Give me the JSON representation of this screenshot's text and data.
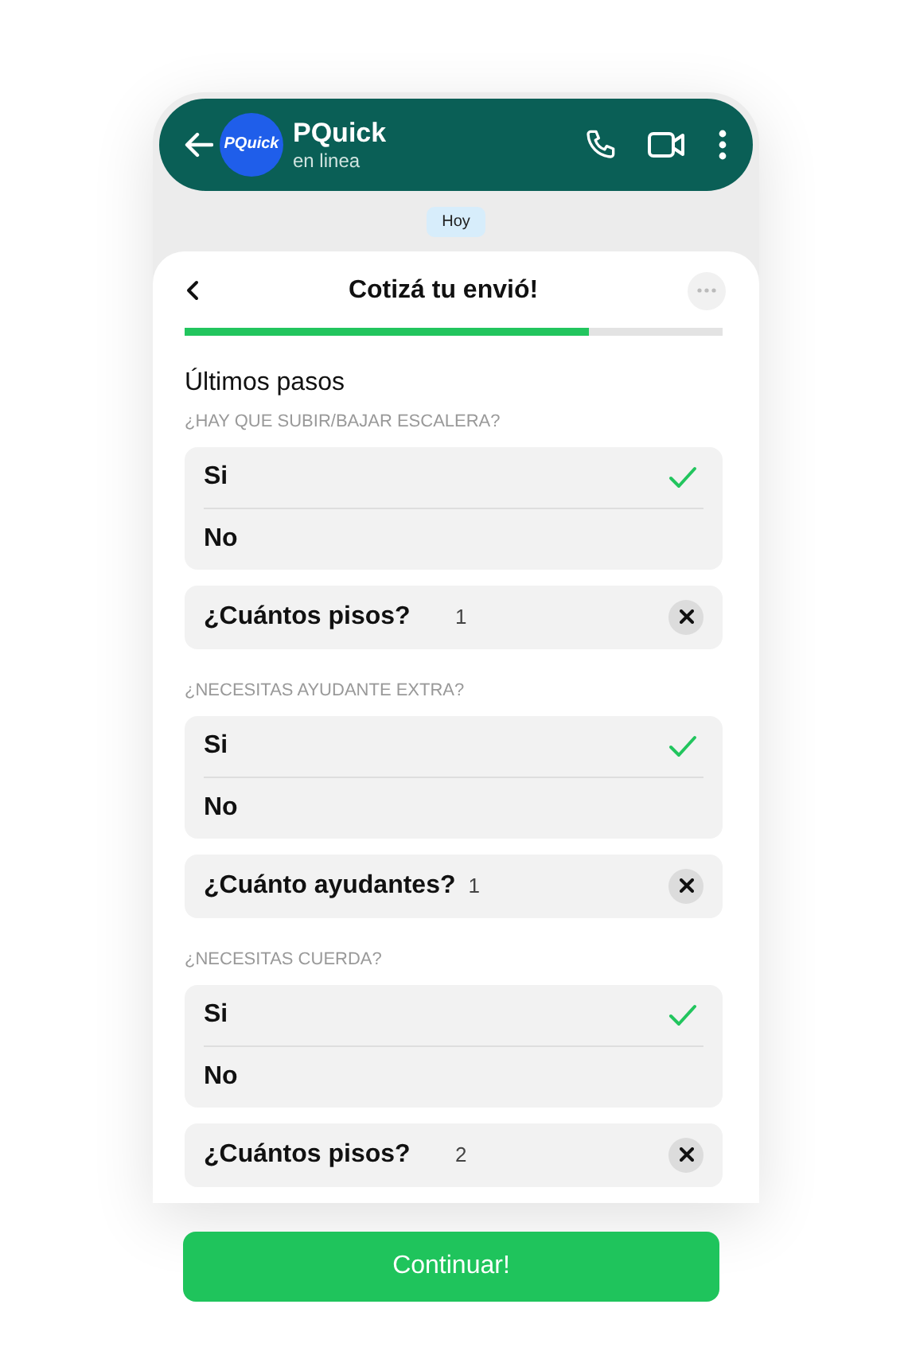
{
  "header": {
    "avatar_text": "PQuick",
    "name": "PQuick",
    "status": "en linea"
  },
  "date_chip": "Hoy",
  "sheet": {
    "title": "Cotizá tu envió!",
    "progress": {
      "level": 0.75
    },
    "heading": "Últimos pasos",
    "sections": [
      {
        "question": "¿HAY QUE SUBIR/BAJAR ESCALERA?",
        "options": [
          {
            "label": "Si",
            "selected": true
          },
          {
            "label": "No",
            "selected": false
          }
        ],
        "count": {
          "label": "¿Cuántos pisos?",
          "value": "1"
        }
      },
      {
        "question": "¿NECESITAS AYUDANTE EXTRA?",
        "options": [
          {
            "label": "Si",
            "selected": true
          },
          {
            "label": "No",
            "selected": false
          }
        ],
        "count": {
          "label": "¿Cuánto ayudantes?",
          "value": "1"
        }
      },
      {
        "question": "¿NECESITAS CUERDA?",
        "options": [
          {
            "label": "Si",
            "selected": true
          },
          {
            "label": "No",
            "selected": false
          }
        ],
        "count": {
          "label": "¿Cuántos pisos?",
          "value": "2"
        }
      }
    ]
  },
  "button": "Continuar!"
}
